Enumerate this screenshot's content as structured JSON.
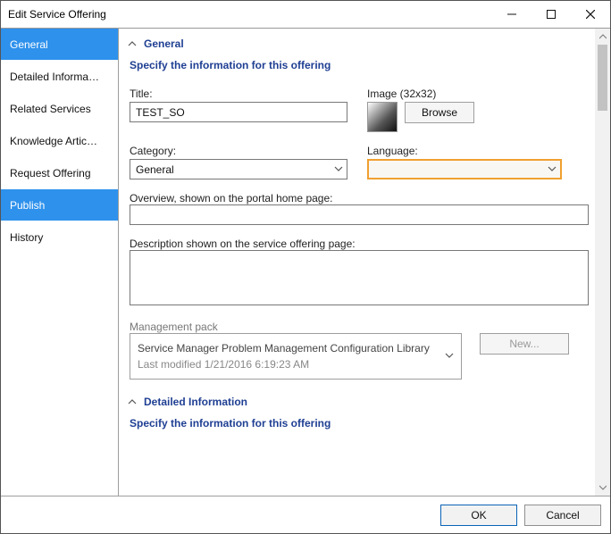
{
  "window": {
    "title": "Edit Service Offering"
  },
  "sidebar": {
    "items": [
      {
        "label": "General"
      },
      {
        "label": "Detailed Informa…"
      },
      {
        "label": "Related Services"
      },
      {
        "label": "Knowledge Artic…"
      },
      {
        "label": "Request Offering"
      },
      {
        "label": "Publish"
      },
      {
        "label": "History"
      }
    ]
  },
  "sections": {
    "general": {
      "header": "General",
      "subtitle": "Specify the information for this offering",
      "title_label": "Title:",
      "title_value": "TEST_SO",
      "image_label": "Image (32x32)",
      "browse_label": "Browse",
      "category_label": "Category:",
      "category_value": "General",
      "language_label": "Language:",
      "language_value": "",
      "overview_label": "Overview, shown on the portal home page:",
      "overview_value": "",
      "description_label": "Description shown on the service offering page:",
      "description_value": "",
      "mgmt_label": "Management pack",
      "mgmt_value_line1": "Service Manager Problem Management Configuration Library",
      "mgmt_value_line2": "Last modified  1/21/2016 6:19:23 AM",
      "new_label": "New..."
    },
    "detailed": {
      "header": "Detailed Information",
      "subtitle": "Specify the information for this offering"
    }
  },
  "footer": {
    "ok": "OK",
    "cancel": "Cancel"
  }
}
